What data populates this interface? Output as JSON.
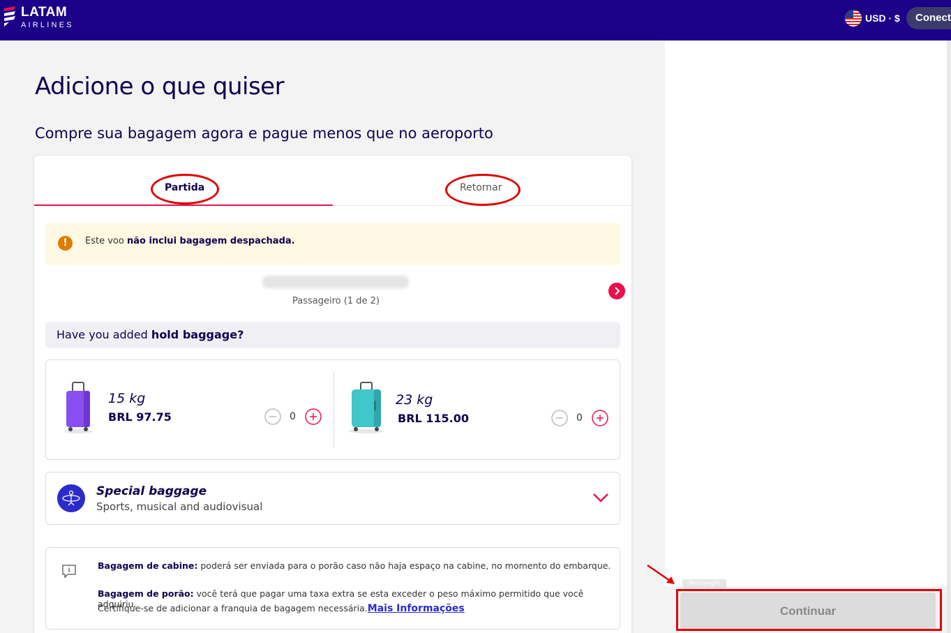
{
  "header": {
    "logo_main": "LATAM",
    "logo_sub": "AIRLINES",
    "currency": "USD · $",
    "connect_label": "Conecte"
  },
  "page": {
    "title": "Adicione o que quiser",
    "subtitle": "Compre sua bagagem agora e pague menos que no aeroporto"
  },
  "tabs": [
    {
      "label": "Partida",
      "active": true
    },
    {
      "label": "Retornar",
      "active": false
    }
  ],
  "alert": {
    "prefix": "Este voo ",
    "bold": "não inclui bagagem despachada."
  },
  "passenger": {
    "label": "Passageiro (1 de 2)"
  },
  "question": {
    "prefix": "Have you added ",
    "bold": "hold baggage?"
  },
  "bags": [
    {
      "weight": "15 kg",
      "price": "BRL 97.75",
      "quantity": "0",
      "color": "#8a4ff0"
    },
    {
      "weight": "23 kg",
      "price": "BRL 115.00",
      "quantity": "0",
      "color": "#3fc7c9"
    }
  ],
  "special": {
    "title": "Special baggage",
    "subtitle": "Sports, musical and audiovisual"
  },
  "info": {
    "cabin_label": "Bagagem de cabine:",
    "cabin_text": " poderá ser enviada para o porão caso não haja espaço na cabine, no momento do embarque.",
    "hold_label": "Bagagem de porão:",
    "hold_text": " você terá que pagar uma taxa extra se esta exceder o peso máximo permitido que você adquiriu.",
    "hold_text2": "Certifique-se de adicionar a franquia de bagagem necessária.",
    "link": "Mais Informações"
  },
  "footer": {
    "tooltip": "Rectangle",
    "continue_label": "Continuar"
  },
  "colors": {
    "brand_navy": "#1b0088",
    "accent_red": "#e8114b",
    "annotation_red": "#e00000"
  }
}
